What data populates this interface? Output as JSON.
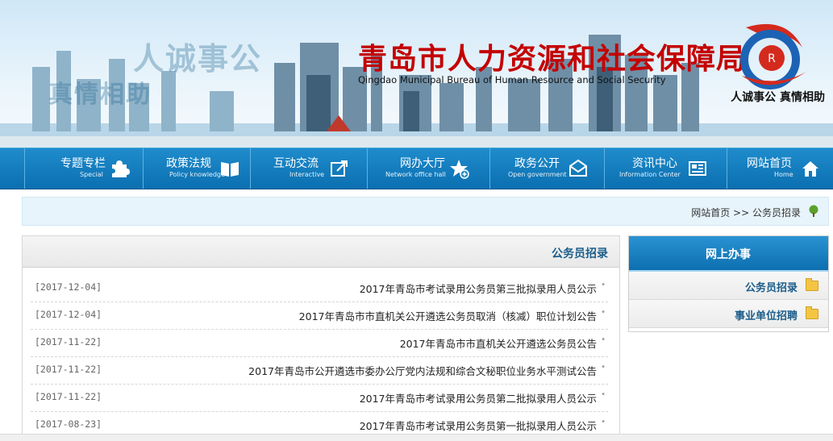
{
  "header": {
    "title_cn": "青岛市人力资源和社会保障局",
    "title_en": "Qingdao Municipal Bureau of Human Resource and Social Security",
    "slogan": "人诚事公 真情相助",
    "faint_slogan_a": "人诚事公",
    "faint_slogan_b": "真情相助"
  },
  "nav": {
    "items": [
      {
        "cn": "网站首页",
        "en": "Home",
        "icon": "home-icon"
      },
      {
        "cn": "资讯中心",
        "en": "Information Center",
        "icon": "newspaper-icon"
      },
      {
        "cn": "政务公开",
        "en": "Open government",
        "icon": "envelope-icon"
      },
      {
        "cn": "网办大厅",
        "en": "Network office hall",
        "icon": "star-icon"
      },
      {
        "cn": "互动交流",
        "en": "Interactive",
        "icon": "share-icon"
      },
      {
        "cn": "政策法规",
        "en": "Policy knowledge",
        "icon": "book-icon"
      },
      {
        "cn": "专题专栏",
        "en": "Special",
        "icon": "puzzle-icon"
      }
    ]
  },
  "breadcrumb": {
    "home": "网站首页",
    "sep": ">>",
    "current": "公务员招录"
  },
  "main": {
    "title": "公务员招录",
    "rows": [
      {
        "title": "2017年青岛市考试录用公务员第三批拟录用人员公示",
        "date": "[2017-12-04]"
      },
      {
        "title": "2017年青岛市市直机关公开遴选公务员取消（核减）职位计划公告",
        "date": "[2017-12-04]"
      },
      {
        "title": "2017年青岛市市直机关公开遴选公务员公告",
        "date": "[2017-11-22]"
      },
      {
        "title": "2017年青岛市公开遴选市委办公厅党内法规和综合文秘职位业务水平测试公告",
        "date": "[2017-11-22]"
      },
      {
        "title": "2017年青岛市考试录用公务员第二批拟录用人员公示",
        "date": "[2017-11-22]"
      },
      {
        "title": "2017年青岛市考试录用公务员第一批拟录用人员公示",
        "date": "[2017-08-23]"
      }
    ]
  },
  "sidebar": {
    "title": "网上办事",
    "items": [
      {
        "label": "公务员招录"
      },
      {
        "label": "事业单位招聘"
      }
    ]
  },
  "colors": {
    "nav_blue": "#0b6fb0",
    "title_red": "#c40000",
    "link_blue": "#1b5d8b"
  }
}
